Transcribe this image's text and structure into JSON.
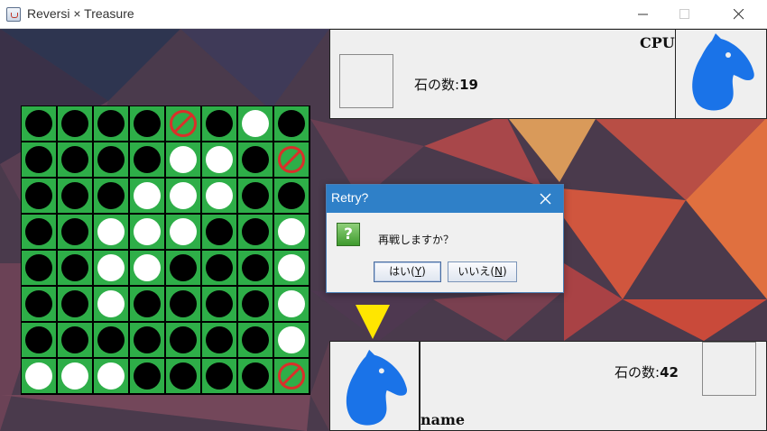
{
  "window": {
    "title": "Reversi × Treasure"
  },
  "cpu_panel": {
    "name": "CPU",
    "count_label": "石の数:",
    "count": "19"
  },
  "player_panel": {
    "name": "name",
    "count_label": "石の数:",
    "count": "42"
  },
  "board": [
    [
      "b",
      "b",
      "b",
      "b",
      "x",
      "b",
      "w",
      "b"
    ],
    [
      "b",
      "b",
      "b",
      "b",
      "w",
      "w",
      "b",
      "x"
    ],
    [
      "b",
      "b",
      "b",
      "w",
      "w",
      "w",
      "b",
      "b"
    ],
    [
      "b",
      "b",
      "w",
      "w",
      "w",
      "b",
      "b",
      "w"
    ],
    [
      "b",
      "b",
      "w",
      "w",
      "b",
      "b",
      "b",
      "w"
    ],
    [
      "b",
      "b",
      "w",
      "b",
      "b",
      "b",
      "b",
      "w"
    ],
    [
      "b",
      "b",
      "b",
      "b",
      "b",
      "b",
      "b",
      "w"
    ],
    [
      "w",
      "w",
      "w",
      "b",
      "b",
      "b",
      "b",
      "x"
    ]
  ],
  "dialog": {
    "title": "Retry?",
    "message": "再戦しますか？",
    "yes_prefix": "はい(",
    "yes_mnemonic": "Y",
    "yes_suffix": ")",
    "no_prefix": "いいえ(",
    "no_mnemonic": "N",
    "no_suffix": ")"
  },
  "colors": {
    "board_green": "#2eae48",
    "horse_blue": "#1a73e8",
    "turn_arrow": "#ffe600",
    "dialog_title_bar": "#2f80c8"
  },
  "icons": {
    "app": "java-cup-icon",
    "player": "horse-head-icon",
    "question": "question-icon",
    "forbidden": "no-entry-icon"
  }
}
